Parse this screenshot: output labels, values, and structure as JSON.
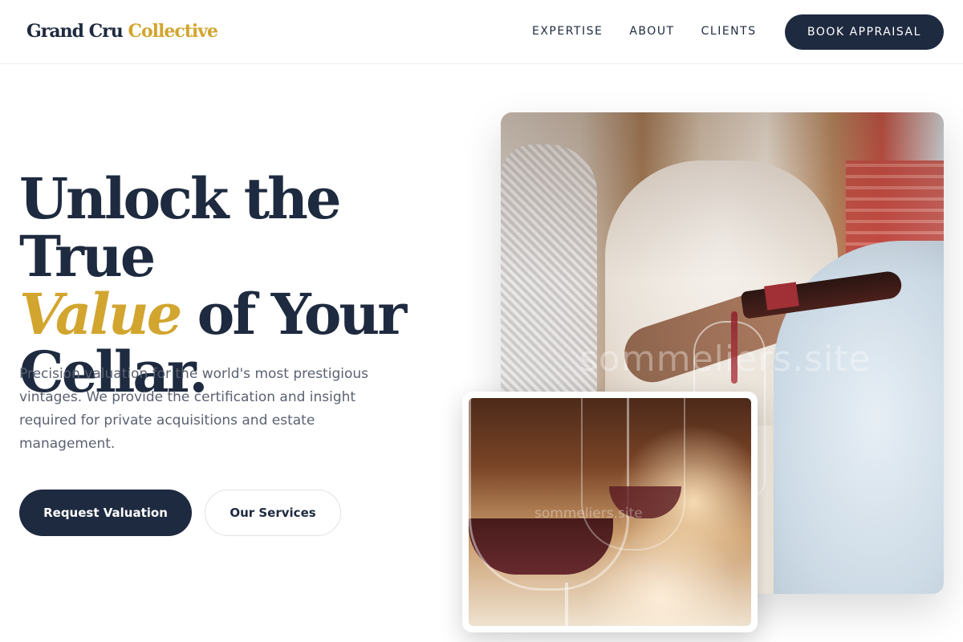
{
  "brand": {
    "name_primary": "Grand Cru",
    "name_accent": "Collective"
  },
  "nav": {
    "items": [
      {
        "label": "EXPERTISE"
      },
      {
        "label": "ABOUT"
      },
      {
        "label": "CLIENTS"
      }
    ],
    "cta_label": "BOOK APPRAISAL"
  },
  "hero": {
    "headline_line1": "Unlock the True",
    "headline_accent": "Value",
    "headline_line2_rest": " of Your",
    "headline_line3": "Cellar.",
    "lead": "Precision valuation for the world's most prestigious vintages. We provide the certification and insight required for private acquisitions and estate management.",
    "primary_button": "Request Valuation",
    "secondary_button": "Our Services"
  },
  "images": {
    "main_watermark": "sommeliers.site",
    "inset_watermark": "sommeliers.site"
  },
  "colors": {
    "navy": "#1e2a3f",
    "gold": "#d2a52f",
    "text_muted": "#5a6170"
  }
}
